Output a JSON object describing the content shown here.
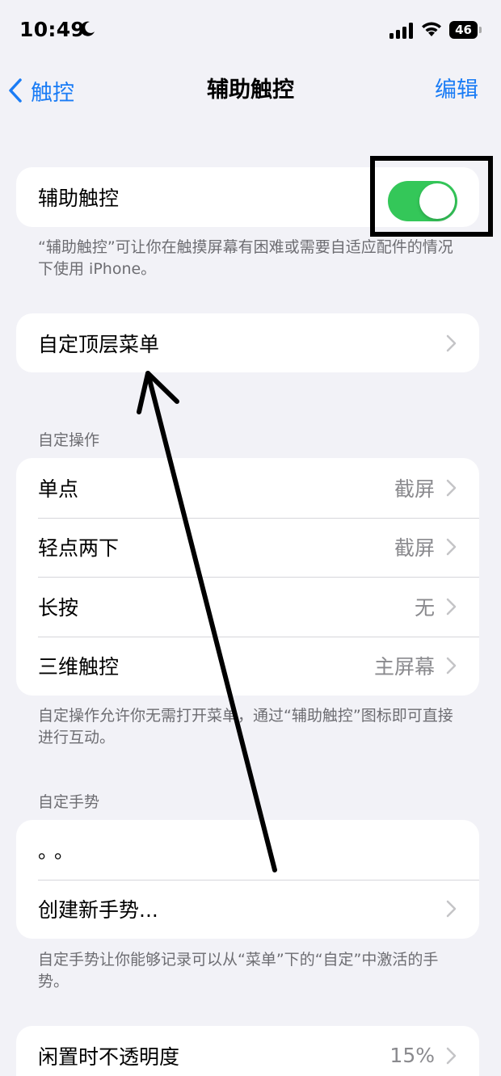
{
  "status_bar": {
    "time": "10:49",
    "battery": "46",
    "icons": [
      "moon-icon",
      "signal-icon",
      "wifi-icon",
      "battery-icon"
    ]
  },
  "nav": {
    "back_label": "触控",
    "title": "辅助触控",
    "edit_label": "编辑"
  },
  "assistive_touch": {
    "label": "辅助触控",
    "enabled": true,
    "toggle_color": "#34c759",
    "footnote": "“辅助触控”可让你在触摸屏幕有困难或需要自适应配件的情况下使用 iPhone。"
  },
  "top_menu": {
    "label": "自定顶层菜单"
  },
  "custom_actions": {
    "header": "自定操作",
    "rows": [
      {
        "label": "单点",
        "value": "截屏"
      },
      {
        "label": "轻点两下",
        "value": "截屏"
      },
      {
        "label": "长按",
        "value": "无"
      },
      {
        "label": "三维触控",
        "value": "主屏幕"
      }
    ],
    "footnote": "自定操作允许你无需打开菜单，通过“辅助触控”图标即可直接进行互动。"
  },
  "custom_gestures": {
    "header": "自定手势",
    "dots": "。。",
    "create_label": "创建新手势...",
    "footnote": "自定手势让你能够记录可以从“菜单”下的“自定”中激活的手势。"
  },
  "idle_opacity": {
    "label": "闲置时不透明度",
    "value": "15%"
  },
  "colors": {
    "accent": "#1a7cf5",
    "background": "#f2f2f7",
    "toggle_on": "#34c759"
  }
}
